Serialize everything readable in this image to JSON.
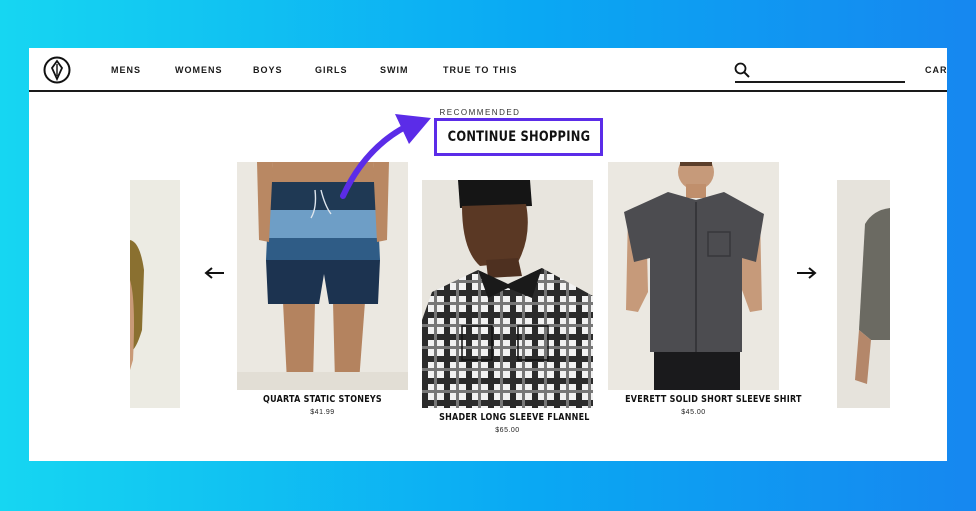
{
  "colors": {
    "background_gradient_start": "#16d6f2",
    "background_gradient_end": "#1687f0",
    "highlight": "#5b2ce8",
    "text": "#111111"
  },
  "nav": {
    "logo_icon": "volcom-stone-logo-icon",
    "items": [
      "MENS",
      "WOMENS",
      "BOYS",
      "GIRLS",
      "SWIM",
      "TRUE TO THIS"
    ],
    "search_icon": "search-icon",
    "search_placeholder": "",
    "cart_label": "CART"
  },
  "recommended_label": "RECOMMENDED",
  "cta_label": "CONTINUE SHOPPING",
  "carousel": {
    "prev_icon": "arrow-left-icon",
    "next_icon": "arrow-right-icon",
    "products": [
      {
        "name": "QUARTA STATIC STONEYS",
        "price": "$41.99"
      },
      {
        "name": "SHADER LONG SLEEVE FLANNEL",
        "price": "$65.00"
      },
      {
        "name": "EVERETT SOLID SHORT SLEEVE SHIRT",
        "price": "$45.00"
      }
    ]
  }
}
